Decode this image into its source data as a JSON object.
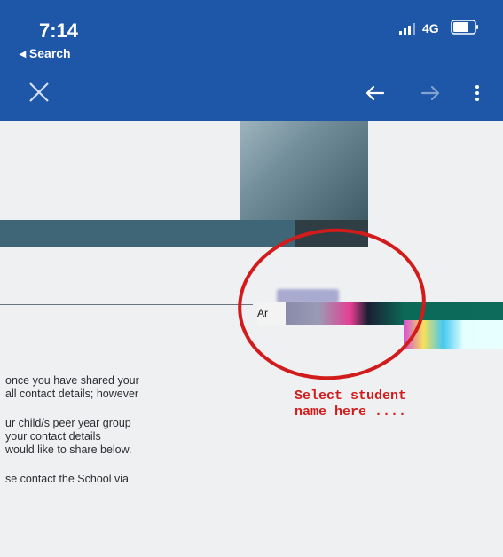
{
  "status_bar": {
    "time": "7:14",
    "network": "4G",
    "back_app_label": "◂ Search"
  },
  "browser": {
    "close_icon": "close-icon",
    "back_icon": "arrow-left-icon",
    "forward_icon": "arrow-right-icon",
    "menu_icon": "kebab-menu-icon"
  },
  "annotation": {
    "line1": "Select  student",
    "line2": "name here ....",
    "color": "#d21c1c"
  },
  "field": {
    "visible_prefix": "Ar"
  },
  "body": {
    "para1": [
      "once you have shared your",
      "all contact details; however"
    ],
    "para2": [
      "ur child/s peer year group",
      " your contact details",
      "would like to share below."
    ],
    "para3": [
      "se contact the School via"
    ]
  },
  "colors": {
    "header_blue": "#1e56a8",
    "banner_band": "#3e6677",
    "page_bg": "#eff0f2"
  }
}
